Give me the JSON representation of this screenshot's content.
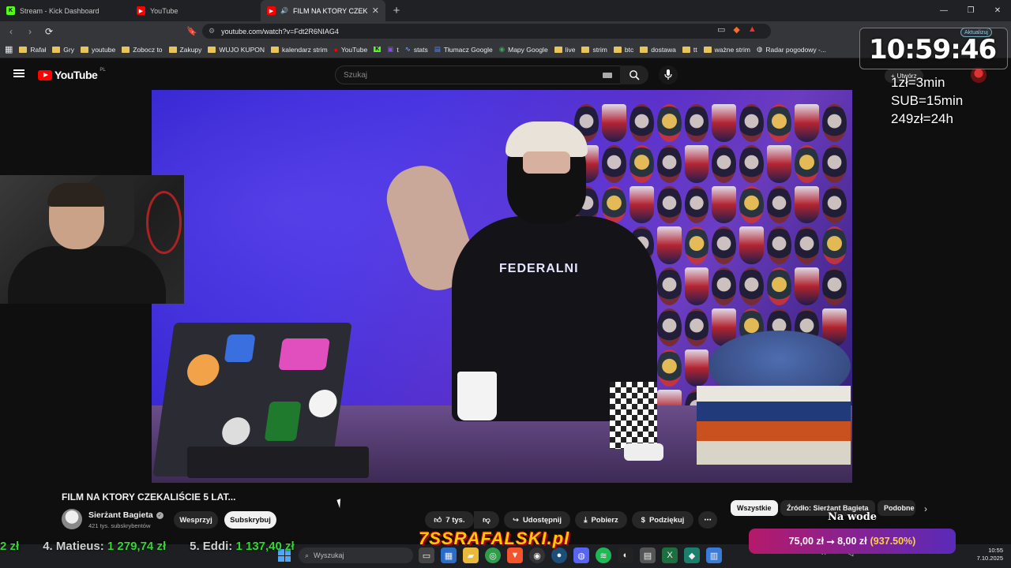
{
  "browser": {
    "tabs": [
      {
        "label": "Stream - Kick Dashboard",
        "icon": "kick-icon",
        "color": "#53fc18"
      },
      {
        "label": "YouTube",
        "icon": "youtube-icon",
        "color": "#ff0000"
      },
      {
        "label": "FILM NA KTORY CZEKALIŚCIE",
        "icon": "youtube-icon",
        "color": "#ff0000",
        "active": true
      }
    ],
    "url": "youtube.com/watch?v=Fdt2R6NIAG4",
    "update_label": "Aktualizuj",
    "bookmarks": [
      {
        "label": "Rafał",
        "type": "folder"
      },
      {
        "label": "Gry",
        "type": "folder"
      },
      {
        "label": "youtube",
        "type": "folder"
      },
      {
        "label": "Zobocz to",
        "type": "folder"
      },
      {
        "label": "Zakupy",
        "type": "folder"
      },
      {
        "label": "WUJO KUPON",
        "type": "folder"
      },
      {
        "label": "kalendarz strim",
        "type": "folder"
      },
      {
        "label": "YouTube",
        "type": "site"
      },
      {
        "label": "",
        "type": "site"
      },
      {
        "label": "t",
        "type": "site"
      },
      {
        "label": "stats",
        "type": "site"
      },
      {
        "label": "Tłumacz Google",
        "type": "site"
      },
      {
        "label": "Mapy Google",
        "type": "site"
      },
      {
        "label": "live",
        "type": "folder"
      },
      {
        "label": "strim",
        "type": "folder"
      },
      {
        "label": "btc",
        "type": "folder"
      },
      {
        "label": "dostawa",
        "type": "folder"
      },
      {
        "label": "tt",
        "type": "folder"
      },
      {
        "label": "ważne strim",
        "type": "folder"
      },
      {
        "label": "Radar pogodowy -...",
        "type": "site"
      }
    ]
  },
  "youtube": {
    "logo_text": "YouTube",
    "logo_region": "PL",
    "search_placeholder": "Szukaj",
    "create_label": "Utwórz",
    "video": {
      "title": "FILM NA KTORY CZEKALIŚCIE 5 LAT...",
      "shirt_text": "FEDERALNI",
      "channel_name": "Sierżant Bagieta",
      "subscribers": "421 tys. subskrybentów",
      "support_label": "Wesprzyj",
      "subscribe_label": "Subskrybuj",
      "likes": "7 tys.",
      "share_label": "Udostępnij",
      "download_label": "Pobierz",
      "thanks_label": "Podziękuj",
      "more_label": "⋯"
    },
    "chips": [
      {
        "label": "Wszystkie",
        "selected": true
      },
      {
        "label": "Źródło: Sierżant Bagieta",
        "selected": false
      },
      {
        "label": "Podobne",
        "selected": false
      }
    ]
  },
  "overlay": {
    "clock": "10:59:46",
    "rates": [
      "1zł=3min",
      "SUB=15min",
      "249zł=24h"
    ],
    "ticker": [
      {
        "label": "2 zł",
        "amount": ""
      },
      {
        "label": "4. Matieus:",
        "amount": "1 279,74 zł"
      },
      {
        "label": "5. Eddi:",
        "amount": "1 137,40 zł"
      }
    ],
    "brand": "7SSRAFALSKI.pl",
    "brand_sub": "Na wode",
    "goal_main": "75,00 zł ⭢ 8,00 zł",
    "goal_pct": "(937.50%)"
  },
  "taskbar": {
    "search_placeholder": "Wyszukaj",
    "time": "10:55",
    "date": "7.10.2025"
  }
}
